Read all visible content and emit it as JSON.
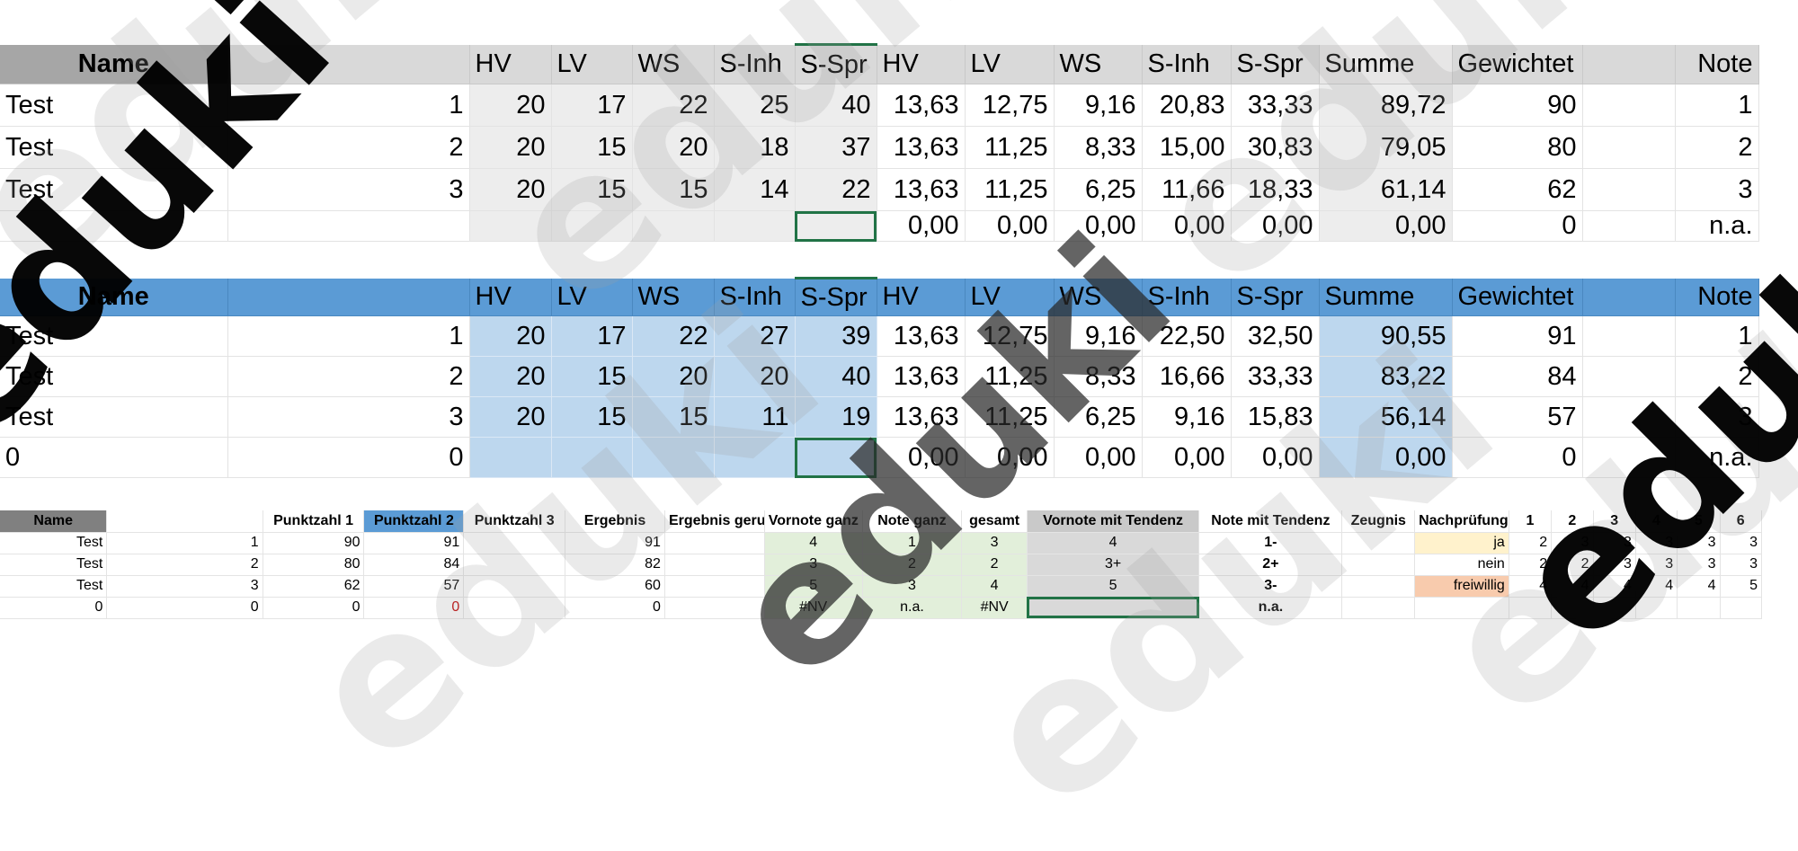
{
  "table1": {
    "header": [
      "Name",
      "",
      "HV",
      "LV",
      "WS",
      "S-Inh",
      "S-Spr",
      "HV",
      "LV",
      "WS",
      "S-Inh",
      "S-Spr",
      "Summe",
      "Gewichtet",
      "",
      "Note"
    ],
    "rows": [
      [
        "Test",
        "1",
        "20",
        "17",
        "22",
        "25",
        "40",
        "13,63",
        "12,75",
        "9,16",
        "20,83",
        "33,33",
        "89,72",
        "90",
        "",
        "1"
      ],
      [
        "Test",
        "2",
        "20",
        "15",
        "20",
        "18",
        "37",
        "13,63",
        "11,25",
        "8,33",
        "15,00",
        "30,83",
        "79,05",
        "80",
        "",
        "2"
      ],
      [
        "Test",
        "3",
        "20",
        "15",
        "15",
        "14",
        "22",
        "13,63",
        "11,25",
        "6,25",
        "11,66",
        "18,33",
        "61,14",
        "62",
        "",
        "3"
      ],
      [
        "",
        "",
        "",
        "",
        "",
        "",
        "",
        "0,00",
        "0,00",
        "0,00",
        "0,00",
        "0,00",
        "0,00",
        "0",
        "",
        "n.a."
      ]
    ]
  },
  "table2": {
    "header": [
      "Name",
      "",
      "HV",
      "LV",
      "WS",
      "S-Inh",
      "S-Spr",
      "HV",
      "LV",
      "WS",
      "S-Inh",
      "S-Spr",
      "Summe",
      "Gewichtet",
      "",
      "Note"
    ],
    "rows": [
      [
        "Test",
        "1",
        "20",
        "17",
        "22",
        "27",
        "39",
        "13,63",
        "12,75",
        "9,16",
        "22,50",
        "32,50",
        "90,55",
        "91",
        "",
        "1"
      ],
      [
        "Test",
        "2",
        "20",
        "15",
        "20",
        "20",
        "40",
        "13,63",
        "11,25",
        "8,33",
        "16,66",
        "33,33",
        "83,22",
        "84",
        "",
        "2"
      ],
      [
        "Test",
        "3",
        "20",
        "15",
        "15",
        "11",
        "19",
        "13,63",
        "11,25",
        "6,25",
        "9,16",
        "15,83",
        "56,14",
        "57",
        "",
        "3"
      ],
      [
        "0",
        "0",
        "",
        "",
        "",
        "",
        "",
        "0,00",
        "0,00",
        "0,00",
        "0,00",
        "0,00",
        "0,00",
        "0",
        "",
        "n.a."
      ]
    ]
  },
  "table3": {
    "header": [
      "Name",
      "",
      "Punktzahl 1",
      "Punktzahl 2",
      "Punktzahl 3",
      "Ergebnis",
      "Ergebnis gerundet",
      "Vornote ganz",
      "Note ganz",
      "gesamt",
      "Vornote mit Tendenz",
      "Note mit Tendenz",
      "Zeugnis",
      "Nachprüfung",
      "1",
      "2",
      "3",
      "4",
      "5",
      "6"
    ],
    "rows": [
      [
        "Test",
        "1",
        "90",
        "91",
        "",
        "91",
        "",
        "4",
        "1",
        "3",
        "4",
        "1-",
        "",
        "ja",
        "2",
        "3",
        "3",
        "3",
        "3",
        "3"
      ],
      [
        "Test",
        "2",
        "80",
        "84",
        "",
        "82",
        "",
        "3",
        "2",
        "2",
        "3+",
        "2+",
        "",
        "nein",
        "2",
        "2",
        "3",
        "3",
        "3",
        "3"
      ],
      [
        "Test",
        "3",
        "62",
        "57",
        "",
        "60",
        "",
        "5",
        "3",
        "4",
        "5",
        "3-",
        "",
        "freiwillig",
        "4",
        "4",
        "4",
        "4",
        "4",
        "5"
      ],
      [
        "0",
        "0",
        "0",
        "0",
        "",
        "0",
        "",
        "#NV",
        "n.a.",
        "#NV",
        "",
        "n.a.",
        "",
        "",
        "",
        "",
        "",
        "",
        "",
        ""
      ]
    ]
  },
  "watermark": {
    "text": "eduki"
  },
  "colors": {
    "grey_header": "#d9d9d9",
    "blue_header": "#5b9bd5",
    "blue_input": "#bdd7ee",
    "excel_green": "#217346"
  }
}
